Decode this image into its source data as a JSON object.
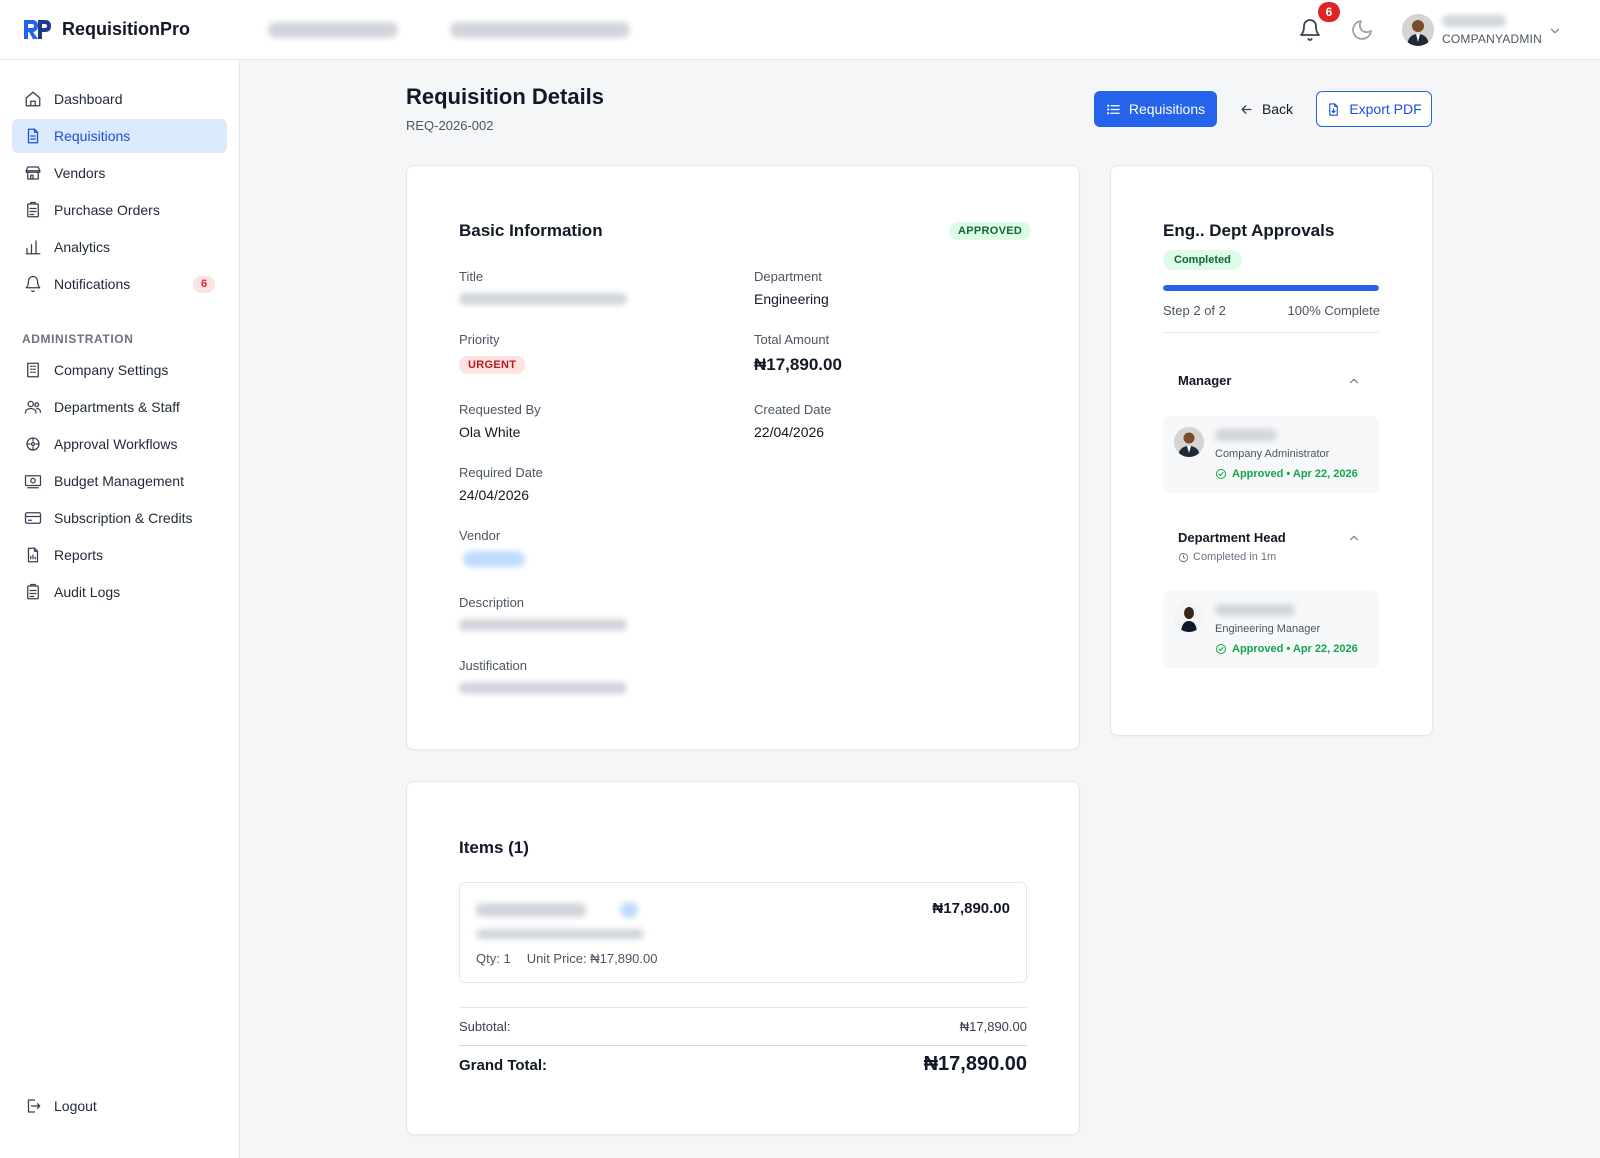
{
  "app": {
    "name": "RequisitionPro",
    "notification_count": "6",
    "user_role": "COMPANYADMIN"
  },
  "sidebar": {
    "items": [
      {
        "label": "Dashboard"
      },
      {
        "label": "Requisitions"
      },
      {
        "label": "Vendors"
      },
      {
        "label": "Purchase Orders"
      },
      {
        "label": "Analytics"
      },
      {
        "label": "Notifications",
        "badge": "6"
      }
    ],
    "admin_label": "ADMINISTRATION",
    "admin_items": [
      {
        "label": "Company Settings"
      },
      {
        "label": "Departments & Staff"
      },
      {
        "label": "Approval Workflows"
      },
      {
        "label": "Budget Management"
      },
      {
        "label": "Subscription & Credits"
      },
      {
        "label": "Reports"
      },
      {
        "label": "Audit Logs"
      }
    ],
    "logout_label": "Logout"
  },
  "page": {
    "title": "Requisition Details",
    "req_id": "REQ-2026-002",
    "buttons": {
      "requisitions": "Requisitions",
      "back": "Back",
      "export": "Export PDF"
    }
  },
  "basic_info": {
    "title": "Basic Information",
    "status": "APPROVED",
    "labels": {
      "title": "Title",
      "department": "Department",
      "priority": "Priority",
      "total_amount": "Total Amount",
      "requested_by": "Requested By",
      "created_date": "Created Date",
      "required_date": "Required Date",
      "vendor": "Vendor",
      "description": "Description",
      "justification": "Justification"
    },
    "values": {
      "department": "Engineering",
      "priority": "URGENT",
      "total_amount": "₦17,890.00",
      "requested_by": "Ola White",
      "created_date": "22/04/2026",
      "required_date": "24/04/2026"
    }
  },
  "items": {
    "title": "Items (1)",
    "list": [
      {
        "price": "₦17,890.00",
        "qty": "Qty: 1",
        "unit_price": "Unit Price: ₦17,890.00"
      }
    ],
    "subtotal_label": "Subtotal:",
    "subtotal_value": "₦17,890.00",
    "grand_total_label": "Grand Total:",
    "grand_total_value": "₦17,890.00"
  },
  "approvals": {
    "title": "Eng.. Dept Approvals",
    "status": "Completed",
    "progress": 1.0,
    "step_text": "Step 2 of 2",
    "percent_text": "100% Complete",
    "stages": [
      {
        "title": "Manager",
        "approver_role": "Company Administrator",
        "approval_status": "Approved • Apr 22, 2026"
      },
      {
        "title": "Department Head",
        "subtitle": "Completed in 1m",
        "approver_role": "Engineering Manager",
        "approval_status": "Approved • Apr 22, 2026"
      }
    ]
  },
  "colors": {
    "primary": "#2563eb",
    "active_bg": "#dbeafe",
    "success": "#16a34a",
    "danger": "#dc2626"
  }
}
